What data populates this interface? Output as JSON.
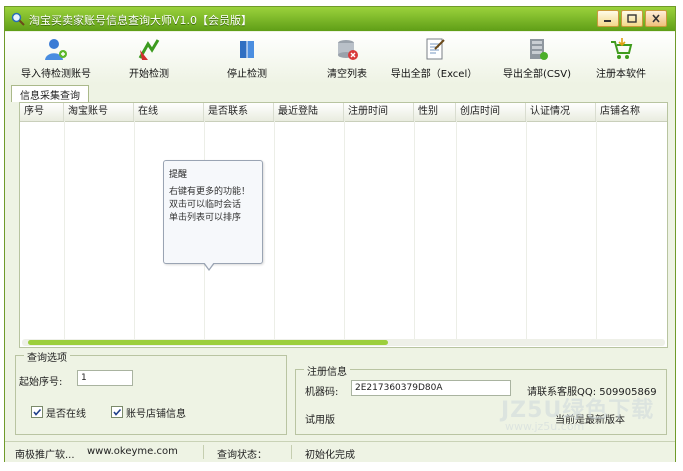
{
  "window": {
    "title": "淘宝买卖家账号信息查询大师V1.0【会员版】",
    "accent": "#6aa81f"
  },
  "toolbar": {
    "items": [
      {
        "label": "导入待检测账号",
        "icon": "user-import-icon"
      },
      {
        "label": "开始检测",
        "icon": "start-arrow-icon"
      },
      {
        "label": "停止检测",
        "icon": "stop-book-icon"
      },
      {
        "label": "清空列表",
        "icon": "clear-database-icon"
      },
      {
        "label": "导出全部（Excel）",
        "icon": "export-excel-icon"
      },
      {
        "label": "导出全部(CSV)",
        "icon": "export-csv-icon"
      },
      {
        "label": "注册本软件",
        "icon": "shopping-cart-icon"
      }
    ]
  },
  "tabs": [
    {
      "label": "信息采集查询"
    }
  ],
  "table": {
    "columns": [
      "序号",
      "淘宝账号",
      "在线",
      "是否联系",
      "最近登陆",
      "注册时间",
      "性别",
      "创店时间",
      "认证情况",
      "店铺名称"
    ],
    "rows": []
  },
  "tooltip": {
    "title": "提醒",
    "lines": [
      "右键有更多的功能！",
      "双击可以临时会话",
      "单击列表可以排序"
    ]
  },
  "query_options": {
    "title": "查询选项",
    "start_label": "起始序号:",
    "start_value": "1",
    "online_label": "是否在线",
    "online_checked": true,
    "shop_label": "账号店铺信息",
    "shop_checked": true
  },
  "register": {
    "title": "注册信息",
    "machine_label": "机器码:",
    "machine_code": "2E217360379D80A",
    "contact": "请联系客服QQ: 509905869",
    "trial": "试用版",
    "version_status": "当前是最新版本"
  },
  "status": {
    "company": "南极推广软...",
    "website": "www.okeyme.com",
    "query_label": "查询状态：",
    "query_value": "初始化完成"
  },
  "watermark": {
    "big": "JZ5U绿色下载",
    "small": "www.jz5u.com"
  }
}
